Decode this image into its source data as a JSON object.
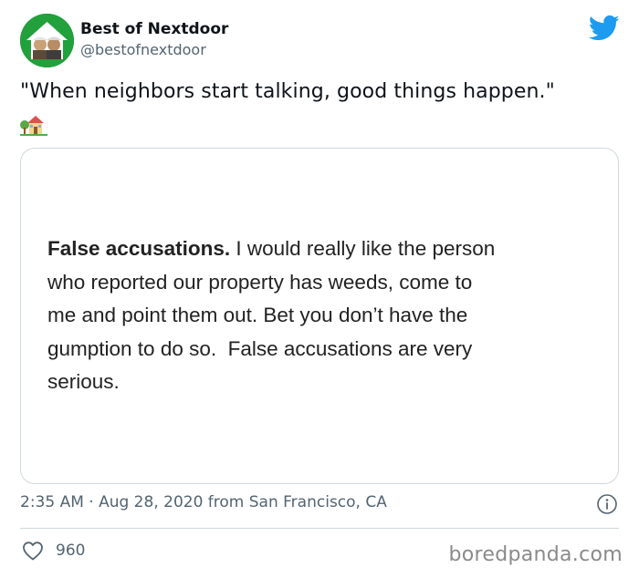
{
  "account": {
    "display_name": "Best of Nextdoor",
    "handle": "@bestofnextdoor",
    "avatar_icon": "nextdoor-house-logo-icon",
    "brand_color": "#21a03b"
  },
  "platform_icon": "twitter-bird-icon",
  "platform_color": "#1d9bf0",
  "tweet": {
    "text": "\"When neighbors start talking, good things happen.\"",
    "emoji": "house-with-garden-icon"
  },
  "embedded_post": {
    "bold_lead": "False accusations.",
    "line1_rest": " I would really like the person",
    "line2": "who reported our property has weeds, come to",
    "line3": "me and point them out. Bet you don’t have the",
    "line4": "gumption to do so.  False accusations are very",
    "line5": "serious."
  },
  "meta": {
    "timestamp": "2:35 AM · Aug 28, 2020 from San Francisco, CA",
    "info_icon": "info-icon"
  },
  "engagement": {
    "like_icon": "heart-icon",
    "likes": "960"
  },
  "watermark": "boredpanda.com"
}
